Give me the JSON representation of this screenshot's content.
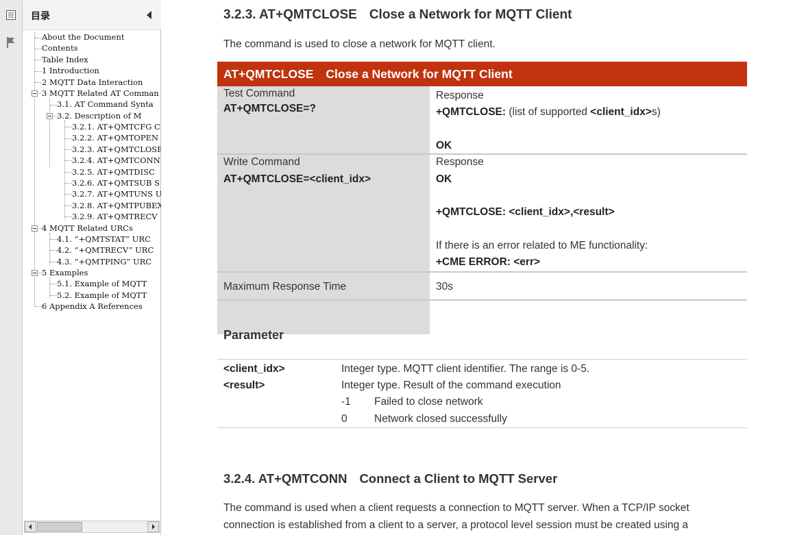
{
  "toc": {
    "title": "目录",
    "items": [
      {
        "label": "About the Document"
      },
      {
        "label": "Contents"
      },
      {
        "label": "Table Index"
      },
      {
        "label": "1 Introduction"
      },
      {
        "label": "2 MQTT Data Interaction"
      },
      {
        "label": "3 MQTT Related AT Comman"
      },
      {
        "label": "3.1. AT Command Synta"
      },
      {
        "label": "3.2. Description of M"
      },
      {
        "label": "3.2.1. AT+QMTCFG C"
      },
      {
        "label": "3.2.2. AT+QMTOPEN"
      },
      {
        "label": "3.2.3. AT+QMTCLOSE"
      },
      {
        "label": "3.2.4. AT+QMTCONN"
      },
      {
        "label": "3.2.5. AT+QMTDISC"
      },
      {
        "label": "3.2.6. AT+QMTSUB S"
      },
      {
        "label": "3.2.7. AT+QMTUNS U"
      },
      {
        "label": "3.2.8. AT+QMTPUBEX"
      },
      {
        "label": "3.2.9. AT+QMTRECV"
      },
      {
        "label": "4 MQTT Related URCs"
      },
      {
        "label": "4.1. “+QMTSTAT” URC"
      },
      {
        "label": "4.2. “+QMTRECV” URC"
      },
      {
        "label": "4.3. “+QMTPING” URC"
      },
      {
        "label": "5 Examples"
      },
      {
        "label": "5.1. Example of MQTT"
      },
      {
        "label": "5.2. Example of MQTT"
      },
      {
        "label": "6 Appendix A References"
      }
    ]
  },
  "doc": {
    "section1": {
      "number": "3.2.3.",
      "command": "AT+QMTCLOSE",
      "title": "Close a Network for MQTT Client"
    },
    "intro": "The command is used to close a network for MQTT client.",
    "table": {
      "header_cmd": "AT+QMTCLOSE",
      "header_title": "Close a Network for MQTT Client",
      "test": {
        "label": "Test Command",
        "syntax": "AT+QMTCLOSE=?",
        "response_label": "Response",
        "resp_cmd": "+QMTCLOSE:",
        "resp_pre": "(list of supported ",
        "resp_param": "<client_idx>",
        "resp_post": "s)",
        "ok": "OK"
      },
      "write": {
        "label": "Write Command",
        "syntax": "AT+QMTCLOSE=<client_idx>",
        "response_label": "Response",
        "ok": "OK",
        "urc": "+QMTCLOSE: <client_idx>,<result>",
        "err_note": "If there is an error related to ME functionality:",
        "cme": "+CME ERROR: <err>"
      },
      "max_time": {
        "label": "Maximum Response Time",
        "value": "30s"
      }
    },
    "parameter": {
      "heading": "Parameter",
      "rows": [
        {
          "name": "<client_idx>",
          "desc": "Integer type. MQTT client identifier. The range is 0-5."
        },
        {
          "name": "<result>",
          "desc": "Integer type. Result of the command execution"
        }
      ],
      "values": [
        {
          "code": "-1",
          "desc": "Failed to close network"
        },
        {
          "code": "0",
          "desc": "Network closed successfully"
        }
      ]
    },
    "section2": {
      "number": "3.2.4.",
      "command": "AT+QMTCONN",
      "title": "Connect a Client to MQTT Server"
    },
    "section2_text_line1": "The command is used when a client requests a connection to MQTT server. When a TCP/IP socket",
    "section2_text_line2": "connection is established from a client to a server, a protocol level session must be created using a"
  }
}
